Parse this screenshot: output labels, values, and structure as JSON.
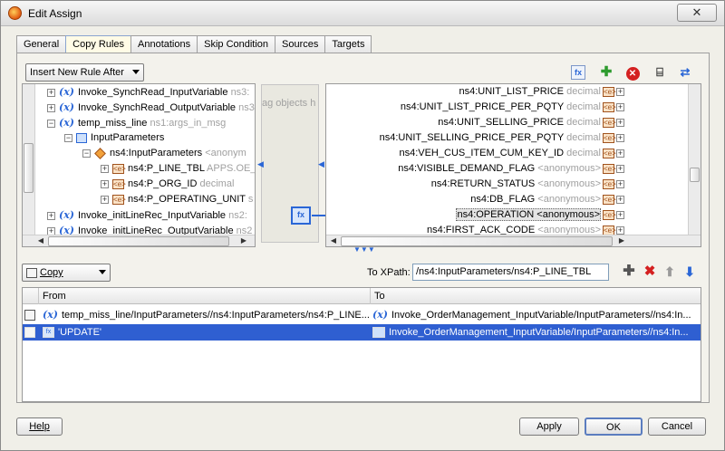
{
  "window": {
    "title": "Edit Assign",
    "close_label": "✕"
  },
  "tabs": [
    "General",
    "Copy Rules",
    "Annotations",
    "Skip Condition",
    "Sources",
    "Targets"
  ],
  "active_tab": "Copy Rules",
  "insert_rule": {
    "selected": "Insert New Rule After"
  },
  "source_tree": {
    "rows": [
      {
        "name": "Invoke_SynchRead_InputVariable",
        "type": "ns3:"
      },
      {
        "name": "Invoke_SynchRead_OutputVariable",
        "type": "ns3:"
      },
      {
        "name": "temp_miss_line",
        "type": "ns1:args_in_msg"
      },
      {
        "name": "InputParameters",
        "type": ""
      },
      {
        "name": "ns4:InputParameters",
        "type": "<anonym"
      },
      {
        "name": "ns4:P_LINE_TBL",
        "type": "APPS.OE_"
      },
      {
        "name": "ns4:P_ORG_ID",
        "type": "decimal"
      },
      {
        "name": "ns4:P_OPERATING_UNIT",
        "type": "s"
      },
      {
        "name": "Invoke_initLineRec_InputVariable",
        "type": "ns2:"
      },
      {
        "name": "Invoke_initLineRec_OutputVariable",
        "type": "ns2"
      }
    ]
  },
  "mid_hint": "ag objects h",
  "target_tree": {
    "rows": [
      {
        "name": "ns4:UNIT_LIST_PRICE",
        "type": "decimal"
      },
      {
        "name": "ns4:UNIT_LIST_PRICE_PER_PQTY",
        "type": "decimal"
      },
      {
        "name": "ns4:UNIT_SELLING_PRICE",
        "type": "decimal"
      },
      {
        "name": "ns4:UNIT_SELLING_PRICE_PER_PQTY",
        "type": "decimal"
      },
      {
        "name": "ns4:VEH_CUS_ITEM_CUM_KEY_ID",
        "type": "decimal"
      },
      {
        "name": "ns4:VISIBLE_DEMAND_FLAG",
        "type": "<anonymous>"
      },
      {
        "name": "ns4:RETURN_STATUS",
        "type": "<anonymous>"
      },
      {
        "name": "ns4:DB_FLAG",
        "type": "<anonymous>"
      },
      {
        "name": "ns4:OPERATION",
        "type": "<anonymous>"
      },
      {
        "name": "ns4:FIRST_ACK_CODE",
        "type": "<anonymous>"
      }
    ]
  },
  "copy_combo": {
    "selected": "Copy"
  },
  "xpath": {
    "label": "To XPath:",
    "value": "/ns4:InputParameters/ns4:P_LINE_TBL"
  },
  "rules_table": {
    "headers": {
      "from": "From",
      "to": "To"
    },
    "rows": [
      {
        "from": "temp_miss_line/InputParameters//ns4:InputParameters/ns4:P_LINE...",
        "to": "Invoke_OrderManagement_InputVariable/InputParameters//ns4:In..."
      },
      {
        "from": "'UPDATE'",
        "to": "Invoke_OrderManagement_InputVariable/InputParameters//ns4:In..."
      }
    ]
  },
  "buttons": {
    "help": "Help",
    "apply": "Apply",
    "ok": "OK",
    "cancel": "Cancel"
  }
}
